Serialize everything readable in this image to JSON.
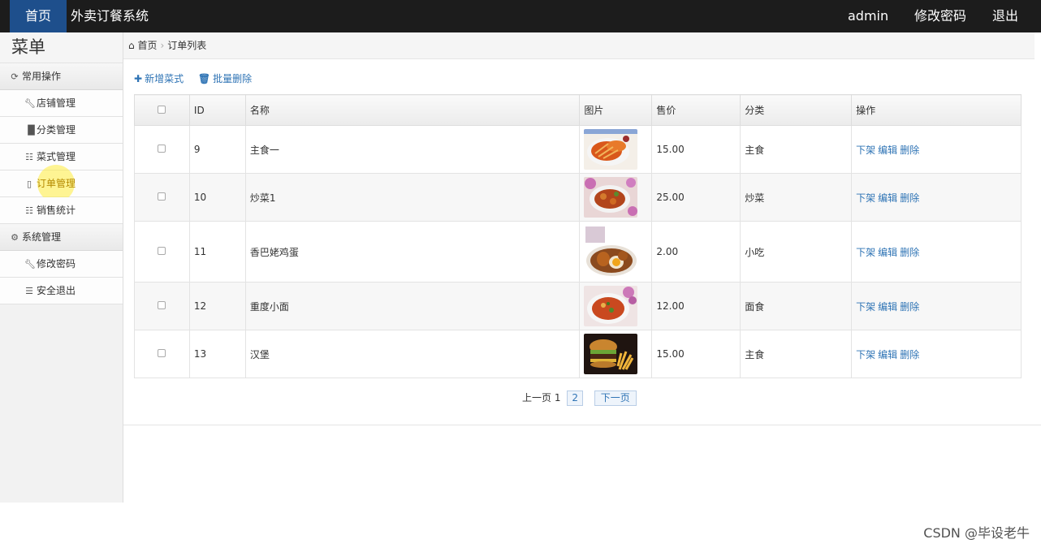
{
  "topbar": {
    "home": "首页",
    "brand": "外卖订餐系统",
    "user": "admin",
    "change_password": "修改密码",
    "logout": "退出"
  },
  "sidebar": {
    "title": "菜单",
    "groups": [
      {
        "label": "常用操作",
        "icon": "refresh-icon",
        "items": [
          {
            "label": "店铺管理",
            "icon": "wrench-icon"
          },
          {
            "label": "分类管理",
            "icon": "books-icon"
          },
          {
            "label": "菜式管理",
            "icon": "list-icon"
          },
          {
            "label": "订单管理",
            "icon": "file-icon"
          },
          {
            "label": "销售统计",
            "icon": "list-icon"
          }
        ]
      },
      {
        "label": "系统管理",
        "icon": "gear-icon",
        "items": [
          {
            "label": "修改密码",
            "icon": "wrench-icon"
          },
          {
            "label": "安全退出",
            "icon": "menu-icon"
          }
        ]
      }
    ]
  },
  "breadcrumb": {
    "home": "首页",
    "current": "订单列表"
  },
  "toolbar": {
    "add": "新增菜式",
    "batch_delete": "批量删除"
  },
  "table": {
    "headers": [
      "ID",
      "名称",
      "图片",
      "售价",
      "分类",
      "操作"
    ],
    "rows": [
      {
        "id": "9",
        "name": "主食一",
        "price": "15.00",
        "category": "主食",
        "image": "fried-shrimp-photo"
      },
      {
        "id": "10",
        "name": "炒菜1",
        "price": "25.00",
        "category": "炒菜",
        "image": "stir-fry-photo"
      },
      {
        "id": "11",
        "name": "香巴姥鸡蛋",
        "price": "2.00",
        "category": "小吃",
        "image": "braised-egg-photo"
      },
      {
        "id": "12",
        "name": "重度小面",
        "price": "12.00",
        "category": "面食",
        "image": "noodle-bowl-photo"
      },
      {
        "id": "13",
        "name": "汉堡",
        "price": "15.00",
        "category": "主食",
        "image": "burger-fries-photo"
      }
    ],
    "ops": [
      "下架",
      "编辑",
      "删除"
    ]
  },
  "pager": {
    "prev": "上一页",
    "current": "1",
    "page2": "2",
    "next": "下一页"
  },
  "watermark": "CSDN @毕设老牛",
  "colors": {
    "topbar": "#1c1c1c",
    "home_tab": "#1e4f8c",
    "link": "#2f74b5"
  }
}
